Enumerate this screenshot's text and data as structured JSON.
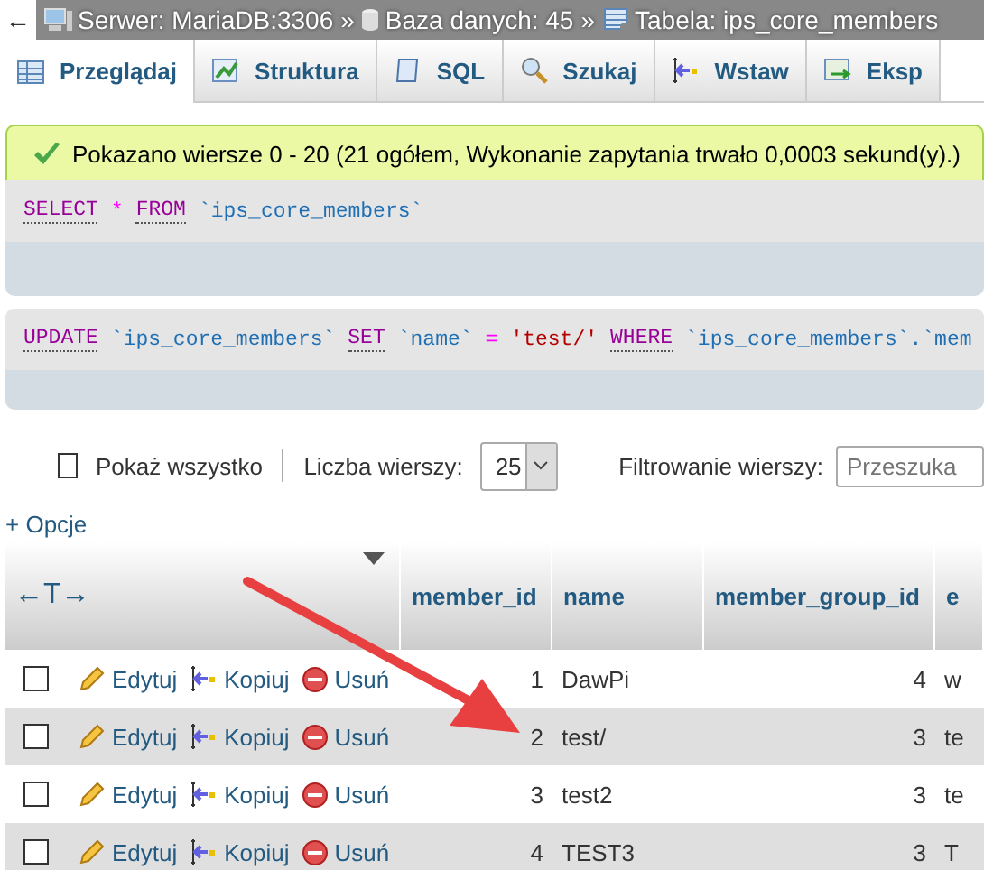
{
  "breadcrumb": [
    {
      "kind": "server",
      "text": "Serwer: MariaDB:3306"
    },
    {
      "kind": "sep",
      "text": "»"
    },
    {
      "kind": "database",
      "text": "Baza danych: 45"
    },
    {
      "kind": "sep",
      "text": "»"
    },
    {
      "kind": "table",
      "text": "Tabela: ips_core_members"
    }
  ],
  "back": "←",
  "tabs": [
    {
      "label": "Przeglądaj",
      "selected": true
    },
    {
      "label": "Struktura",
      "selected": false
    },
    {
      "label": "SQL",
      "selected": false
    },
    {
      "label": "Szukaj",
      "selected": false
    },
    {
      "label": "Wstaw",
      "selected": false
    },
    {
      "label": "Eksp",
      "selected": false
    }
  ],
  "notice": "Pokazano wiersze 0 - 20 (21 ogółem, Wykonanie zapytania trwało 0,0003 sekund(y).)",
  "queries": [
    [
      {
        "kind": "keyword",
        "text": "SELECT"
      },
      {
        "kind": "operator",
        "text": "*"
      },
      {
        "kind": "keyword",
        "text": "FROM"
      },
      {
        "kind": "identifier",
        "text": "`ips_core_members`"
      }
    ],
    [
      {
        "kind": "keyword",
        "text": "UPDATE"
      },
      {
        "kind": "identifier",
        "text": "`ips_core_members`"
      },
      {
        "kind": "keyword",
        "text": "SET"
      },
      {
        "kind": "identifier",
        "text": "`name`"
      },
      {
        "kind": "operator",
        "text": "="
      },
      {
        "kind": "string",
        "text": "'test/'"
      },
      {
        "kind": "keyword",
        "text": "WHERE"
      },
      {
        "kind": "identifier",
        "text": "`ips_core_members`.`mem"
      }
    ]
  ],
  "controls": {
    "show_all": {
      "label": "Pokaż wszystko",
      "checked": false
    },
    "rows_label": "Liczba wierszy:",
    "rows_value": "25",
    "filter_label": "Filtrowanie wierszy:",
    "filter_placeholder": "Przeszuka"
  },
  "options_link": "+ Opcje",
  "table": {
    "resize_icon": "←T→",
    "columns": [
      "member_id",
      "name",
      "member_group_id",
      "e"
    ],
    "rows": [
      {
        "checked": false,
        "actions": [
          "Edytuj",
          "Kopiuj",
          "Usuń"
        ],
        "cells": [
          "1",
          "DawPi",
          "4",
          "w"
        ]
      },
      {
        "checked": false,
        "actions": [
          "Edytuj",
          "Kopiuj",
          "Usuń"
        ],
        "cells": [
          "2",
          "test/",
          "3",
          "te"
        ]
      },
      {
        "checked": false,
        "actions": [
          "Edytuj",
          "Kopiuj",
          "Usuń"
        ],
        "cells": [
          "3",
          "test2",
          "3",
          "te"
        ]
      },
      {
        "checked": false,
        "actions": [
          "Edytuj",
          "Kopiuj",
          "Usuń"
        ],
        "cells": [
          "4",
          "TEST3",
          "3",
          "T"
        ]
      }
    ]
  }
}
